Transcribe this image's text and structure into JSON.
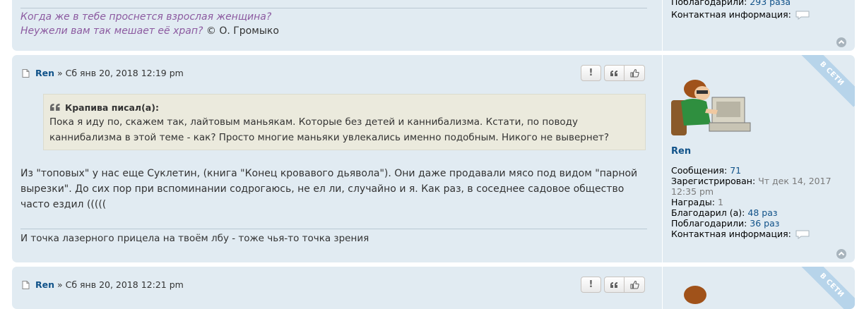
{
  "post1": {
    "sig_line1": "Когда же в тебе проснется взрослая женщина?",
    "sig_line2_italic": "Неужели вам так мешает её храп?",
    "sig_line2_author": "© О. Громыко",
    "profile": {
      "thanked_label": "Поблагодарили:",
      "thanked_value": "293 раза",
      "contact_label": "Контактная информация:"
    }
  },
  "post2": {
    "author": "Ren",
    "sep": "»",
    "date": "Сб янв 20, 2018 12:19 pm",
    "buttons": {
      "report": "!",
      "quote": "❝",
      "like": "like"
    },
    "online_badge": "В СЕТИ",
    "quote": {
      "cite": "Крапива писал(а):",
      "line1": "Пока я иду по, скажем так, лайтовым маньякам. Которые без детей и каннибализма. Кстати, по поводу",
      "line2": "каннибализма в этой теме - как? Просто многие маньяки увлекались именно подобным. Никого не вывернет?"
    },
    "body": {
      "line1": "Из \"топовых\" у нас еще Суклетин, (книга \"Конец кровавого дьявола\"). Они даже продавали мясо под видом \"парной",
      "line2": "вырезки\". До сих пор при вспоминании содрогаюсь, не ел ли, случайно и я. Как раз, в соседнее садовое общество",
      "line3": "часто ездил ((((("
    },
    "signature": "И точка лазерного прицела на твоём лбу - тоже чья-то точка зрения",
    "profile": {
      "username": "Ren",
      "posts_label": "Сообщения:",
      "posts_value": "71",
      "registered_label": "Зарегистрирован:",
      "registered_value_1": "Чт дек 14, 2017",
      "registered_value_2": "12:35 pm",
      "awards_label": "Награды:",
      "awards_value": "1",
      "thanked_label": "Благодарил (а):",
      "thanked_value": "48 раз",
      "was_thanked_label": "Поблагодарили:",
      "was_thanked_value": "36 раз",
      "contact_label": "Контактная информация:"
    }
  },
  "post3": {
    "author": "Ren",
    "sep": "»",
    "date": "Сб янв 20, 2018 12:21 pm",
    "online_badge": "В СЕТИ"
  }
}
